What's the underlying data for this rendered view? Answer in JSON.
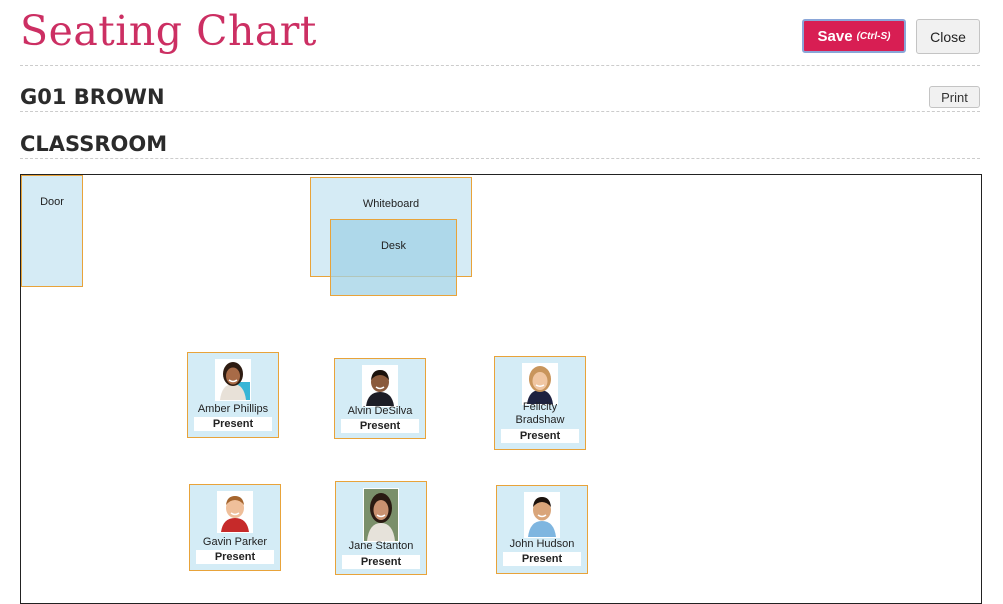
{
  "header": {
    "title": "Seating Chart"
  },
  "toolbar": {
    "save_label": "Save",
    "save_hint": "(Ctrl-S)",
    "close_label": "Close"
  },
  "class_section": {
    "title": "G01 BROWN",
    "print_label": "Print"
  },
  "room_section": {
    "title": "CLASSROOM"
  },
  "fixtures": {
    "door": "Door",
    "whiteboard": "Whiteboard",
    "desk": "Desk"
  },
  "students": [
    {
      "name": "Amber Phillips",
      "status": "Present"
    },
    {
      "name": "Alvin DeSilva",
      "status": "Present"
    },
    {
      "name": "Felicity Bradshaw",
      "status": "Present"
    },
    {
      "name": "Gavin Parker",
      "status": "Present"
    },
    {
      "name": "Jane Stanton",
      "status": "Present"
    },
    {
      "name": "John Hudson",
      "status": "Present"
    }
  ],
  "colors": {
    "title": "#cc2f63",
    "save_button": "#d81e53",
    "fixture_border": "#e8a33a",
    "seat_fill": "#d4ecf6"
  }
}
